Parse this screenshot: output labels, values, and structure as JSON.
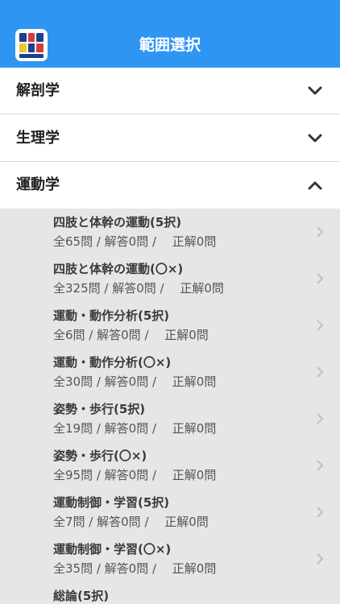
{
  "header": {
    "title": "範囲選択",
    "app_icon": "quiz-app-icon"
  },
  "sections": [
    {
      "label": "解剖学",
      "expanded": false,
      "chevron_icon": "chevron-down-icon"
    },
    {
      "label": "生理学",
      "expanded": false,
      "chevron_icon": "chevron-down-icon"
    },
    {
      "label": "運動学",
      "expanded": true,
      "chevron_icon": "chevron-up-icon"
    }
  ],
  "sub_items": [
    {
      "title": "四肢と体幹の運動(5択)",
      "stats": "全65問 / 解答0問 /　 正解0問"
    },
    {
      "title": "四肢と体幹の運動(〇×)",
      "stats": "全325問 / 解答0問 /　 正解0問"
    },
    {
      "title": "運動・動作分析(5択)",
      "stats": "全6問 / 解答0問 /　 正解0問"
    },
    {
      "title": "運動・動作分析(〇×)",
      "stats": "全30問 / 解答0問 /　 正解0問"
    },
    {
      "title": "姿勢・歩行(5択)",
      "stats": "全19問 / 解答0問 /　 正解0問"
    },
    {
      "title": "姿勢・歩行(〇×)",
      "stats": "全95問 / 解答0問 /　 正解0問"
    },
    {
      "title": "運動制御・学習(5択)",
      "stats": "全7問 / 解答0問 /　 正解0問"
    },
    {
      "title": "運動制御・学習(〇×)",
      "stats": "全35問 / 解答0問 /　 正解0問"
    },
    {
      "title": "総論(5択)",
      "stats": ""
    }
  ],
  "colors": {
    "header_bg": "#2e95f3",
    "list_bg": "#e6e6e6",
    "chevron": "#333333",
    "sub_chevron": "#c0c0c0"
  }
}
